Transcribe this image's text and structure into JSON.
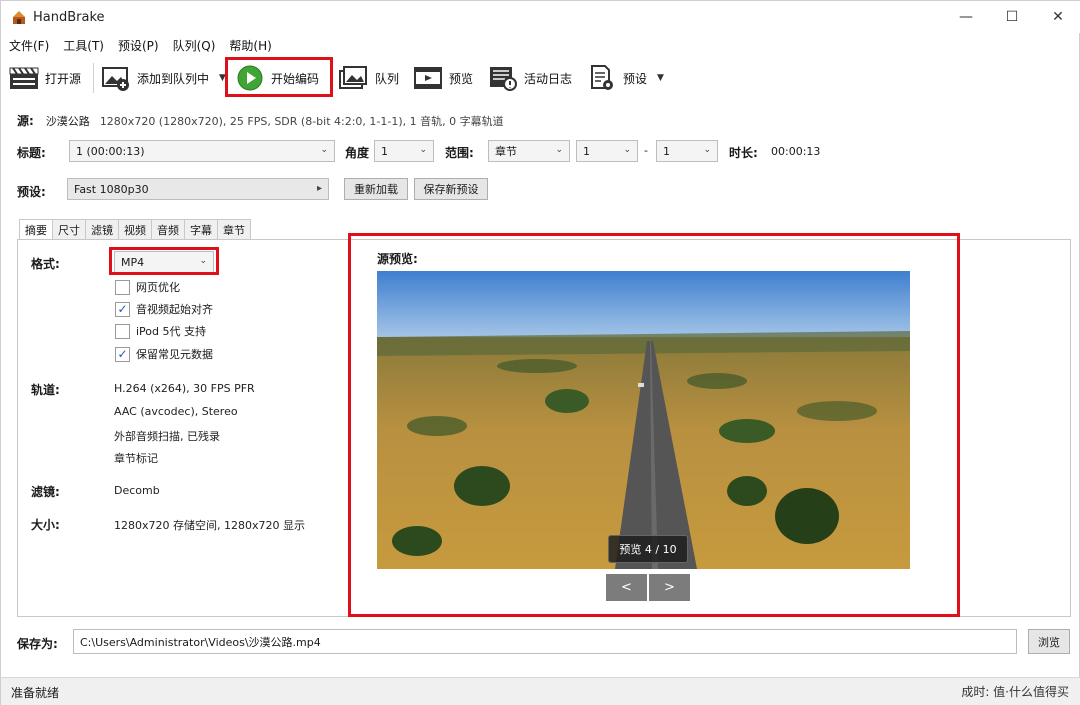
{
  "window": {
    "title": "HandBrake",
    "minimize": "—",
    "maximize": "☐",
    "close": "✕"
  },
  "menu": [
    "文件(F)",
    "工具(T)",
    "预设(P)",
    "队列(Q)",
    "帮助(H)"
  ],
  "toolbar": {
    "open_source": "打开源",
    "add_to_queue": "添加到队列中",
    "start_encode": "开始编码",
    "queue": "队列",
    "preview": "预览",
    "activity_log": "活动日志",
    "presets": "预设"
  },
  "source": {
    "label": "源:",
    "name": "沙漠公路",
    "info": "1280x720 (1280x720), 25 FPS, SDR (8-bit 4:2:0, 1-1-1), 1 音轨, 0 字幕轨道"
  },
  "title_row": {
    "title_label": "标题:",
    "title_value": "1 (00:00:13)",
    "angle_label": "角度",
    "angle_value": "1",
    "range_label": "范围:",
    "range_type": "章节",
    "range_from": "1",
    "range_dash": "-",
    "range_to": "1",
    "duration_label": "时长:",
    "duration_value": "00:00:13"
  },
  "preset_row": {
    "label": "预设:",
    "value": "Fast 1080p30",
    "reload_button": "重新加载",
    "save_new_button": "保存新预设"
  },
  "tabs": [
    "摘要",
    "尺寸",
    "滤镜",
    "视频",
    "音频",
    "字幕",
    "章节"
  ],
  "summary": {
    "format_label": "格式:",
    "format_value": "MP4",
    "checkboxes": [
      {
        "label": "网页优化",
        "checked": false
      },
      {
        "label": "音视频起始对齐",
        "checked": true
      },
      {
        "label": "iPod 5代 支持",
        "checked": false
      },
      {
        "label": "保留常见元数据",
        "checked": true
      }
    ],
    "tracks_label": "轨道:",
    "tracks": [
      "H.264 (x264), 30 FPS PFR",
      "AAC (avcodec), Stereo",
      "外部音频扫描, 已残录",
      "章节标记"
    ],
    "filters_label": "滤镜:",
    "filters_value": "Decomb",
    "size_label": "大小:",
    "size_value": "1280x720 存储空间, 1280x720 显示"
  },
  "preview": {
    "label": "源预览:",
    "badge": "预览 4 / 10",
    "prev_button": "<",
    "next_button": ">"
  },
  "save_row": {
    "label": "保存为:",
    "path": "C:\\Users\\Administrator\\Videos\\沙漠公路.mp4",
    "browse_button": "浏览"
  },
  "status": {
    "text": "准备就绪",
    "right_text": "成时: 值·什么值得买"
  },
  "colors": {
    "highlight": "#e0101a",
    "accent_green": "#3fa535"
  }
}
